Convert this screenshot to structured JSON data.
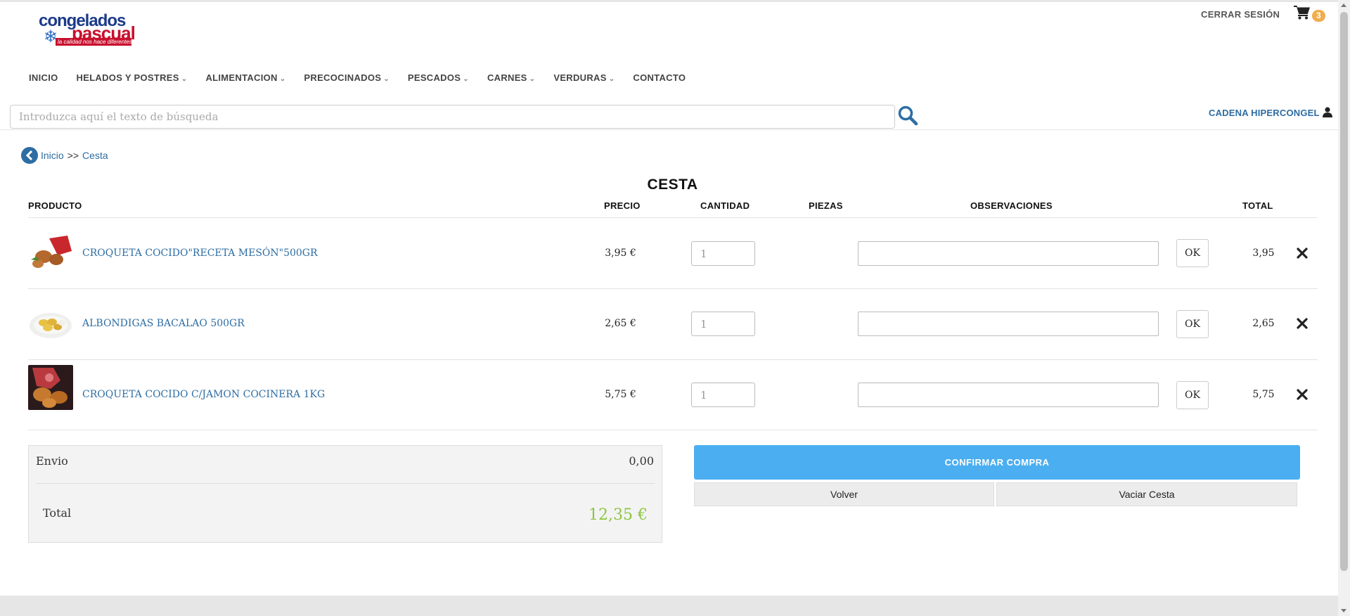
{
  "brand": {
    "logo_line1": "congelados",
    "logo_line2": "pascual",
    "logo_tagline": "la calidad nos hace diferentes"
  },
  "header": {
    "logout_label": "CERRAR SESIÓN",
    "cart_count": "3",
    "user_label": "CADENA HIPERCONGEL"
  },
  "nav": {
    "items": [
      {
        "label": "INICIO",
        "dropdown": false
      },
      {
        "label": "HELADOS Y POSTRES",
        "dropdown": true
      },
      {
        "label": "ALIMENTACION",
        "dropdown": true
      },
      {
        "label": "PRECOCINADOS",
        "dropdown": true
      },
      {
        "label": "PESCADOS",
        "dropdown": true
      },
      {
        "label": "CARNES",
        "dropdown": true
      },
      {
        "label": "VERDURAS",
        "dropdown": true
      },
      {
        "label": "CONTACTO",
        "dropdown": false
      }
    ]
  },
  "search": {
    "placeholder": "Introduzca aquí el texto de búsqueda",
    "value": ""
  },
  "breadcrumb": {
    "home": "Inicio",
    "separator": ">>",
    "current": "Cesta"
  },
  "cart": {
    "title": "CESTA",
    "columns": {
      "product": "PRODUCTO",
      "price": "PRECIO",
      "quantity": "CANTIDAD",
      "pieces": "PIEZAS",
      "notes": "OBSERVACIONES",
      "total": "TOTAL"
    },
    "ok_label": "OK",
    "items": [
      {
        "name": "CROQUETA COCIDO\"RECETA MESÓN\"500GR",
        "price": "3,95 €",
        "quantity": "1",
        "pieces": "",
        "notes": "",
        "total": "3,95"
      },
      {
        "name": "ALBONDIGAS BACALAO 500GR",
        "price": "2,65 €",
        "quantity": "1",
        "pieces": "",
        "notes": "",
        "total": "2,65"
      },
      {
        "name": "CROQUETA COCIDO C/JAMON COCINERA 1KG",
        "price": "5,75 €",
        "quantity": "1",
        "pieces": "",
        "notes": "",
        "total": "5,75"
      }
    ]
  },
  "summary": {
    "shipping_label": "Envio",
    "shipping_value": "0,00",
    "total_label": "Total",
    "total_value": "12,35 €"
  },
  "actions": {
    "confirm_label": "CONFIRMAR COMPRA",
    "back_label": "Volver",
    "empty_label": "Vaciar Cesta"
  },
  "colors": {
    "link": "#2d6da3",
    "confirm": "#4baef0",
    "total": "#8cc63f",
    "badge": "#f0ad4e"
  }
}
